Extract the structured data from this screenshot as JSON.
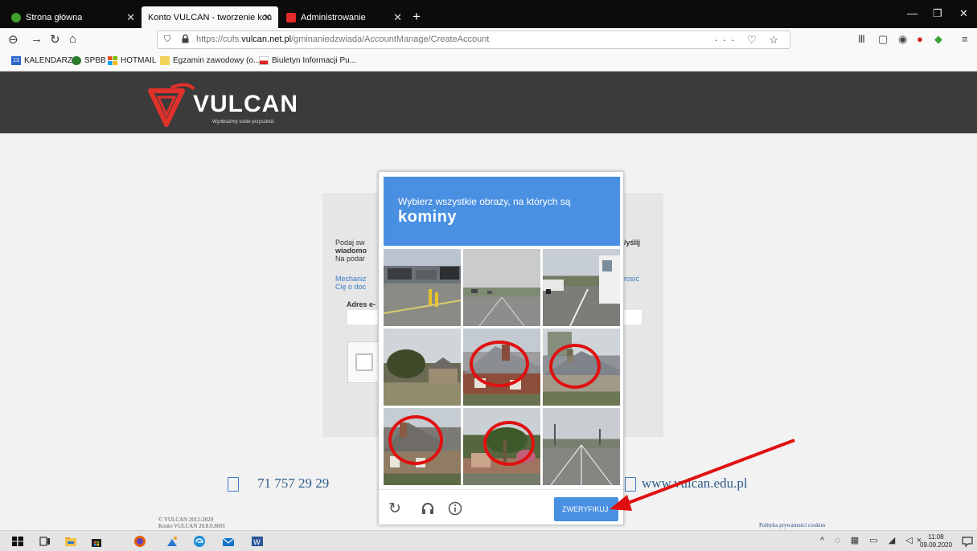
{
  "browser": {
    "tabs": [
      {
        "title": "Strona główna",
        "active": false
      },
      {
        "title": "Konto VULCAN - tworzenie konta",
        "active": true
      },
      {
        "title": "Administrowanie",
        "active": false
      }
    ],
    "url_prefix": "https://cufs.",
    "url_domain": "vulcan.net.pl",
    "url_path": "/gminaniedzwiada/AccountManage/CreateAccount",
    "bookmarks": [
      "KALENDARZ",
      "SPBB",
      "HOTMAIL",
      "Egzamin zawodowy (o...",
      "Biuletyn Informacji Pu..."
    ],
    "bookmark_calendar_badge": "13"
  },
  "site": {
    "logo_text": "VULCAN",
    "tagline": "Wyobraźmy sobie przyszłość",
    "panel": {
      "intro_line1": "Podaj sw",
      "intro_line2_bold": "wiadomo",
      "intro_line3": "Na podar",
      "right_fragment_bold": "/yślij",
      "link_line1": "Mechaniz",
      "link_line2": "Cię o doc",
      "link_right": "rosić",
      "email_label": "Adres e-"
    },
    "phone": "71 757 29 29",
    "website": "www.vulcan.edu.pl",
    "copyright": "© VULCAN 2012-2020",
    "version": "Konto VULCAN 20.8.0.8691",
    "cookie_link": "Polityka prywatności cookies"
  },
  "captcha": {
    "instruction": "Wybierz wszystkie obrazy, na których są",
    "target": "kominy",
    "verify_label": "ZWERYFIKUJ",
    "selected_tiles": [
      4,
      5,
      6,
      7
    ]
  },
  "taskbar": {
    "time": "11:08",
    "date": "09.09.2020"
  },
  "colors": {
    "captcha_blue": "#4a90e2",
    "header_dark": "#3b3b3b",
    "annotation_red": "#e01010"
  }
}
